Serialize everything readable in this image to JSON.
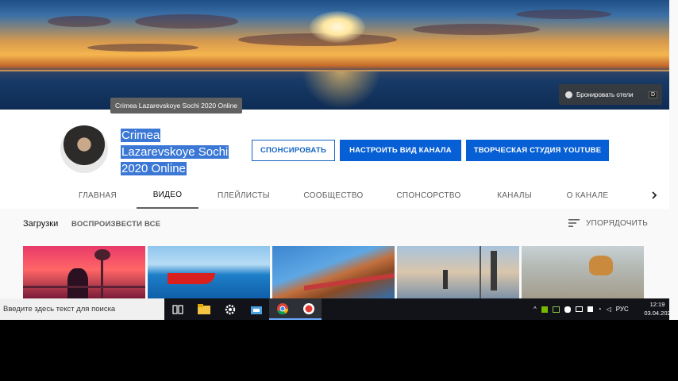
{
  "banner": {
    "hotel_button_label": "Бронировать отели",
    "hotel_button_badge": "D",
    "tooltip": "Crimea Lazarevskoye Sochi 2020 Online"
  },
  "channel": {
    "title_lines": [
      "Crimea",
      "Lazarevskoye Sochi",
      "2020 Online"
    ],
    "buttons": {
      "sponsor": "СПОНСИРОВАТЬ",
      "customize": "НАСТРОИТЬ ВИД КАНАЛА",
      "studio": "ТВОРЧЕСКАЯ СТУДИЯ YOUTUBE"
    }
  },
  "tabs": [
    {
      "label": "ГЛАВНАЯ",
      "active": false
    },
    {
      "label": "ВИДЕО",
      "active": true
    },
    {
      "label": "ПЛЕЙЛИСТЫ",
      "active": false
    },
    {
      "label": "СООБЩЕСТВО",
      "active": false
    },
    {
      "label": "СПОНСОРСТВО",
      "active": false
    },
    {
      "label": "КАНАЛЫ",
      "active": false
    },
    {
      "label": "О КАНАЛЕ",
      "active": false
    }
  ],
  "uploads": {
    "title": "Загрузки",
    "play_all": "ВОСПРОИЗВЕСТИ ВСЕ",
    "sort_label": "УПОРЯДОЧИТЬ"
  },
  "taskbar": {
    "search_placeholder": "Введите здесь текст для поиска",
    "language": "РУС",
    "time": "12:19",
    "date": "03.04.202"
  },
  "colors": {
    "accent": "#065fd4",
    "title_highlight": "#3b78d6",
    "taskbar": "#111318"
  }
}
